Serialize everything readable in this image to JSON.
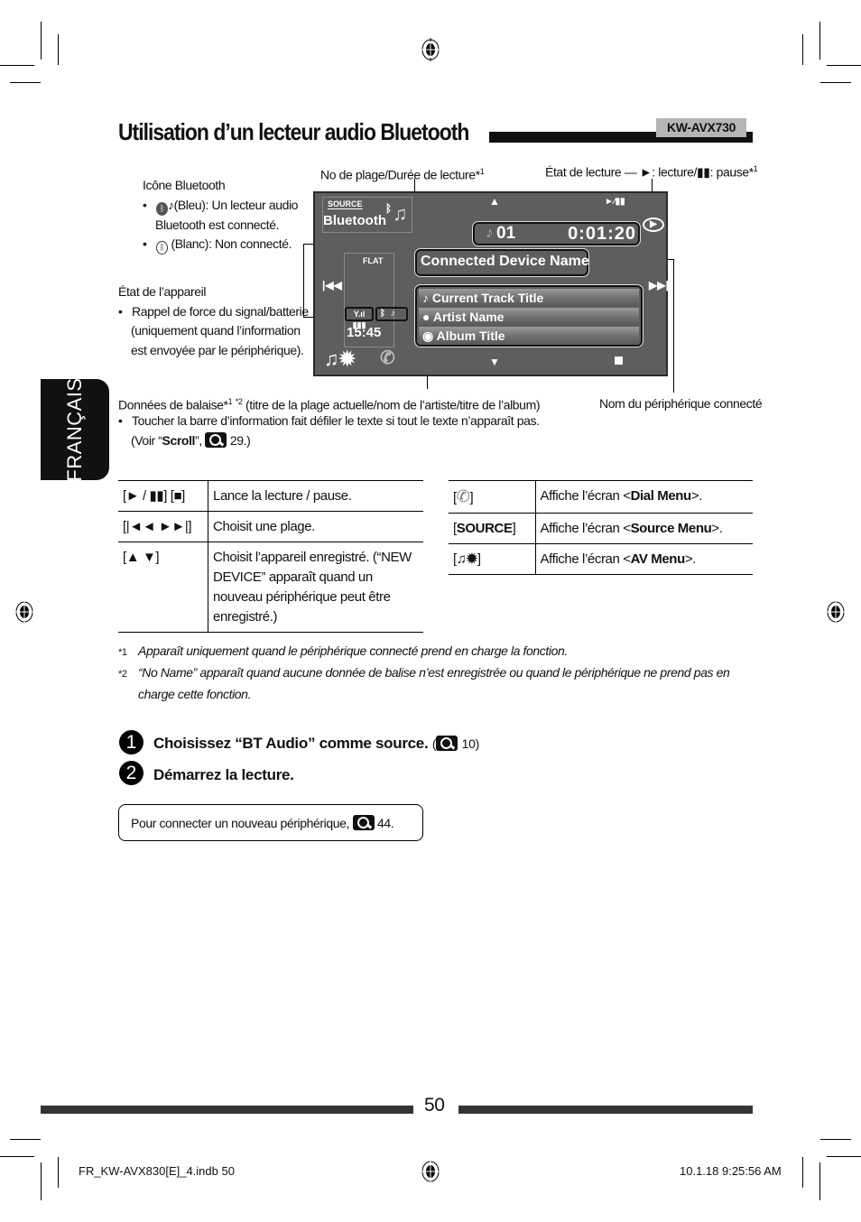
{
  "header": {
    "title": "Utilisation d’un lecteur audio Bluetooth",
    "model": "KW-AVX730"
  },
  "side_tab": {
    "label": "FRANÇAIS"
  },
  "callouts": {
    "track_time": "No de plage/Durée de lecture*",
    "track_time_sup": "1",
    "play_state": "État de lecture — ►: lecture/▮▮: pause*",
    "play_state_sup": "1",
    "bt_icon_title": "Icône Bluetooth",
    "bt_icon_blue": "(Bleu): Un lecteur audio",
    "bt_icon_blue_2": "Bluetooth est connecté.",
    "bt_icon_white": "(Blanc): Non connecté.",
    "device_state_title": "État de l’appareil",
    "device_state_1": "Rappel de force du signal/batterie",
    "device_state_2": "(uniquement quand l’information",
    "device_state_3": "est envoyée par le périphérique).",
    "tag_data": "Données de balaise*",
    "tag_data_sup1": "1",
    "tag_data_sup2": "*2",
    "tag_data_rest": "(titre de la plage actuelle/nom de l’artiste/titre de l’album)",
    "tag_bullet": "Toucher la barre d’information fait défiler le texte si tout le texte n’apparaît pas.",
    "tag_see_pre": "(Voir “",
    "tag_see_bold": "Scroll",
    "tag_see_post": "”,",
    "tag_see_page": "29.)",
    "device_name": "Nom du périphérique connecté"
  },
  "screen": {
    "source_label": "SOURCE",
    "source_name": "Bluetooth",
    "play_pause_label": "►⁄▮▮",
    "track_number": "01",
    "elapsed_time": "0:01:20",
    "device_name": "Connected Device Name",
    "eq_mode": "FLAT",
    "clock": "15:45",
    "info_rows": [
      {
        "icon": "♪",
        "text": "Current Track Title"
      },
      {
        "icon": "●",
        "text": "Artist Name"
      },
      {
        "icon": "◉",
        "text": "Album Title"
      }
    ]
  },
  "table_left": [
    {
      "key": "[► / ▮▮] [■]",
      "desc": "Lance la lecture / pause."
    },
    {
      "key": "[|◄◄ ►►|]",
      "desc": "Choisit une plage."
    },
    {
      "key": "[▲ ▼]",
      "desc": "Choisit l’appareil enregistré. (“NEW DEVICE” apparaît quand un nouveau périphérique peut être enregistré.)"
    }
  ],
  "table_right": [
    {
      "key_icon": "phone-icon",
      "desc_pre": "Affiche l’écran <",
      "desc_bold": "Dial Menu",
      "desc_post": ">."
    },
    {
      "key": "SOURCE",
      "desc_pre": "Affiche l’écran <",
      "desc_bold": "Source Menu",
      "desc_post": ">."
    },
    {
      "key_icon": "av-menu-icon",
      "desc_pre": "Affiche l’écran <",
      "desc_bold": "AV Menu",
      "desc_post": ">."
    }
  ],
  "footnotes": [
    {
      "mark": "*1",
      "text": "Apparaît uniquement quand le périphérique connecté prend en charge la fonction."
    },
    {
      "mark": "*2",
      "text": "“No Name” apparaît quand aucune donnée de balise n’est enregistrée ou quand le périphérique ne prend pas en",
      "text2": "charge cette fonction."
    }
  ],
  "steps": [
    {
      "num": "1",
      "text": "Choisissez “BT Audio” comme source.",
      "ref_open": "(",
      "ref_page": "10)"
    },
    {
      "num": "2",
      "text": "Démarrez la lecture."
    }
  ],
  "note": {
    "text": "Pour connecter un nouveau périphérique,",
    "page": "44."
  },
  "page_number": "50",
  "slug": {
    "file": "FR_KW-AVX830[E]_4.indb   50",
    "date": "10.1.18   9:25:56 AM"
  }
}
